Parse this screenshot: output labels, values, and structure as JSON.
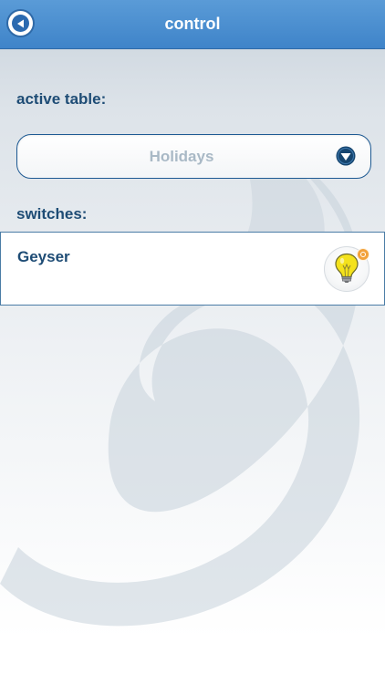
{
  "header": {
    "title": "control",
    "back_icon": "back-arrow-icon"
  },
  "active_table": {
    "label": "active table:",
    "selected": "Holidays",
    "dropdown_icon": "chevron-down-circle-icon"
  },
  "switches": {
    "label": "switches:",
    "items": [
      {
        "name": "Geyser",
        "icon": "light-bulb-icon",
        "badge_icon": "status-badge-icon"
      }
    ]
  },
  "colors": {
    "header_bg": "#3f84c9",
    "label_text": "#1e4c75",
    "dropdown_text": "#a9b9c6",
    "bulb_yellow": "#f4e21c",
    "badge_orange": "#f2a23c"
  }
}
